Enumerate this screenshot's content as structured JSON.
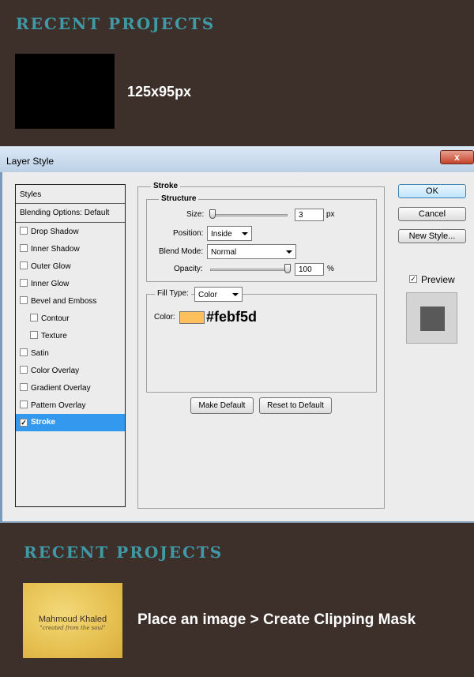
{
  "top": {
    "heading": "RECENT PROJECTS",
    "caption": "125x95px"
  },
  "dialog": {
    "title": "Layer Style",
    "close": "x",
    "styles_header": "Styles",
    "blending": "Blending Options: Default",
    "items": [
      {
        "label": "Drop Shadow",
        "checked": ""
      },
      {
        "label": "Inner Shadow",
        "checked": ""
      },
      {
        "label": "Outer Glow",
        "checked": ""
      },
      {
        "label": "Inner Glow",
        "checked": ""
      },
      {
        "label": "Bevel and Emboss",
        "checked": ""
      },
      {
        "label": "Contour",
        "checked": ""
      },
      {
        "label": "Texture",
        "checked": ""
      },
      {
        "label": "Satin",
        "checked": ""
      },
      {
        "label": "Color Overlay",
        "checked": ""
      },
      {
        "label": "Gradient Overlay",
        "checked": ""
      },
      {
        "label": "Pattern Overlay",
        "checked": ""
      },
      {
        "label": "Stroke",
        "checked": "✓"
      }
    ],
    "stroke": {
      "title": "Stroke",
      "structure": "Structure",
      "size_label": "Size:",
      "size_value": "3",
      "size_unit": "px",
      "position_label": "Position:",
      "position_value": "Inside",
      "blend_label": "Blend Mode:",
      "blend_value": "Normal",
      "opacity_label": "Opacity:",
      "opacity_value": "100",
      "opacity_unit": "%",
      "fill_type_label": "Fill Type:",
      "fill_type_value": "Color",
      "color_label": "Color:",
      "color_hex": "#febf5d",
      "make_default": "Make Default",
      "reset_default": "Reset to Default"
    },
    "ok": "OK",
    "cancel": "Cancel",
    "new_style": "New Style...",
    "preview_label": "Preview",
    "preview_check": "✓"
  },
  "bottom": {
    "heading": "RECENT PROJECTS",
    "thumb_title": "Mahmoud Khaled",
    "thumb_tagline": "\"created from the soul\"",
    "caption": "Place an image > Create Clipping Mask"
  },
  "colors": {
    "stroke_color": "#febf5d",
    "heading": "#3f99a6",
    "background": "#3d2f29"
  }
}
